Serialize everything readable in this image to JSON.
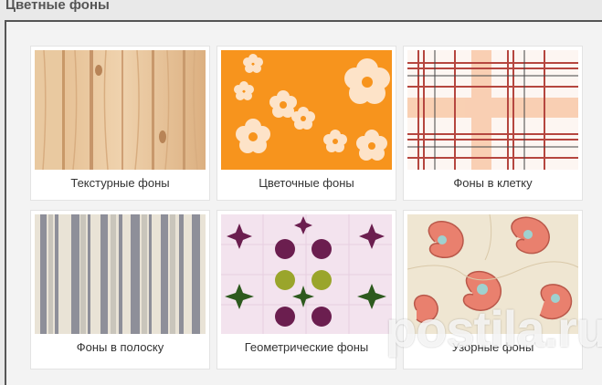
{
  "section": {
    "title": "Цветные фоны"
  },
  "cards": [
    {
      "caption": "Текстурные фоны",
      "pattern": "wood-texture"
    },
    {
      "caption": "Цветочные фоны",
      "pattern": "flower-pattern"
    },
    {
      "caption": "Фоны в клетку",
      "pattern": "plaid-pattern"
    },
    {
      "caption": "Фоны в полоску",
      "pattern": "stripe-pattern"
    },
    {
      "caption": "Геометрические фоны",
      "pattern": "geometric-pattern"
    },
    {
      "caption": "Узорные фоны",
      "pattern": "paisley-pattern"
    }
  ],
  "watermark": {
    "text": "postila.ru"
  },
  "colors": {
    "border": "#555555",
    "wood": "#e8c49a",
    "flower_bg": "#f7941d",
    "plaid_red": "#c0504d",
    "plaid_orange": "#f4a261",
    "stripe_gray": "#9a9aa6",
    "geo_purple": "#6b1e4f",
    "geo_green": "#9aa52b",
    "paisley": "#e9806e"
  }
}
